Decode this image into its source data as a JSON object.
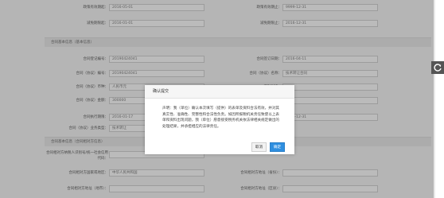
{
  "fields": {
    "r1_l_label": "政策有效期起：",
    "r1_l_value": "2016-05-01",
    "r1_r_label": "政策有效期止：",
    "r1_r_value": "9999-12-31",
    "r2_l_label": "减免期限起：",
    "r2_l_value": "2016-01-01",
    "r2_r_label": "减免期限止：",
    "r2_r_value": "2016-12-31",
    "r3_l_label": "合同登记编号：",
    "r3_l_value": "20190424041",
    "r3_r_label": "合同签订日期：",
    "r3_r_value": "2016-04-11",
    "r4_l_label": "合同（协议）编号：",
    "r4_l_value": "20190424041",
    "r4_r_label": "合同（协议）名称：",
    "r4_r_value": "技术转让合同",
    "r5_l_label": "合同（协议）币种：",
    "r5_l_value": "人民币元",
    "r5_r_label": "币种对换：",
    "r5_r_value": "",
    "r6_l_label": "合同（协议）金额：",
    "r6_l_value": "300000",
    "r6_r_label": "",
    "r6_r_value": "",
    "r7_l_label": "合同执行期限：",
    "r7_l_value": "2016-01-17",
    "r7_r_label": "",
    "r7_r_value": "2016-12-31",
    "r8_l_label": "合同（协议）业务类型：",
    "r8_l_value": "技术转让",
    "r9_l_label": "合同相对方纳税人识别号/统一社会信用代码：",
    "r9_l_value": "",
    "r10_l_label": "合同相对方国家或地区：",
    "r10_l_value": "中华人民共和国",
    "r10_r_label": "合同相对方地址（省份）：",
    "r10_r_value": "",
    "r11_l_label": "合同相对方地址（地市）：",
    "r11_l_value": "",
    "r11_r_label": "合同相对方地址（区县）：",
    "r11_r_value": ""
  },
  "sections": {
    "contract_basic": "合同基本信息（基本信息）",
    "counterparty": "合同基本信息（合同相对方信息）"
  },
  "dialog": {
    "title": "确认提交",
    "text": "声明：我（单位）确认本次填写（提供）的表单及资料合法有效，并对其真实性、准确性、完整性和合法性负责。如因所报税机关责任致使以上表单和资料出现问题，我（单位）愿意接受税务机关依法律相关规定做出的处理结果，并承担相应的法律责任。",
    "cancel": "取消",
    "ok": "确定"
  },
  "icons": {
    "side": "refresh-icon"
  },
  "colors": {
    "primary": "#2f8fe0",
    "overlay": "rgba(40,40,40,0.30)"
  }
}
